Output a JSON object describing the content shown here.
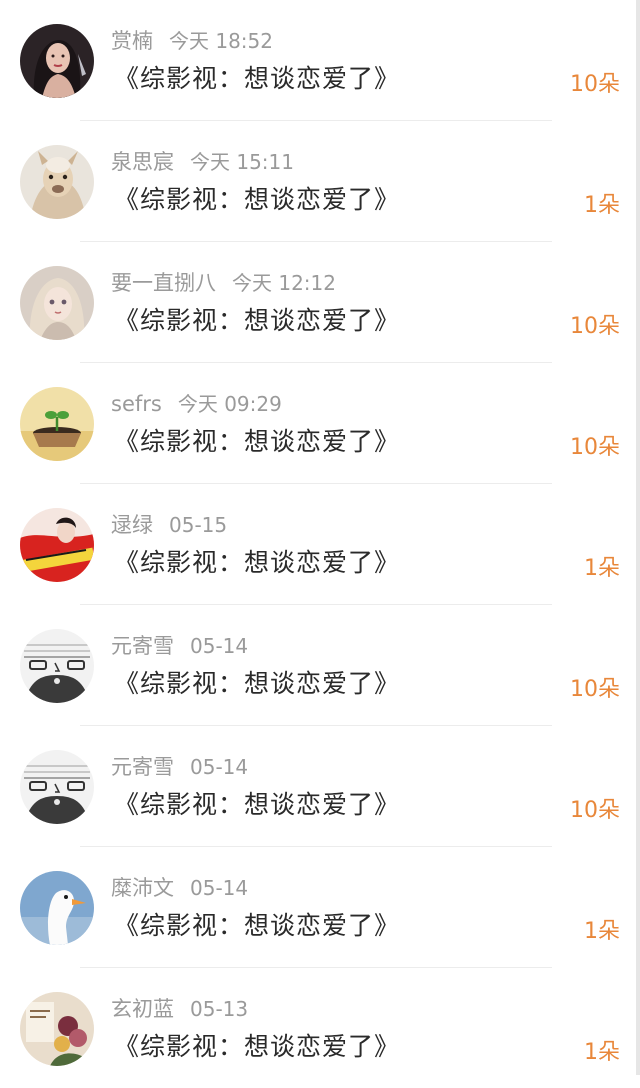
{
  "items": [
    {
      "name": "赏楠",
      "time": "今天 18:52",
      "title": "《综影视：想谈恋爱了》",
      "count": "10朵",
      "avatar": "avatar-woman-dark-hair"
    },
    {
      "name": "泉思宸",
      "time": "今天 15:11",
      "title": "《综影视：想谈恋爱了》",
      "count": "1朵",
      "avatar": "avatar-alpaca"
    },
    {
      "name": "要一直捌八",
      "time": "今天 12:12",
      "title": "《综影视：想谈恋爱了》",
      "count": "10朵",
      "avatar": "avatar-anime-girl"
    },
    {
      "name": "sefrs",
      "time": "今天 09:29",
      "title": "《综影视：想谈恋爱了》",
      "count": "10朵",
      "avatar": "avatar-sprout-pot"
    },
    {
      "name": "逯绿",
      "time": "05-15",
      "title": "《综影视：想谈恋爱了》",
      "count": "1朵",
      "avatar": "avatar-red-dress-woman"
    },
    {
      "name": "元寄雪",
      "time": "05-14",
      "title": "《综影视：想谈恋爱了》",
      "count": "10朵",
      "avatar": "avatar-sketch-face"
    },
    {
      "name": "元寄雪",
      "time": "05-14",
      "title": "《综影视：想谈恋爱了》",
      "count": "10朵",
      "avatar": "avatar-sketch-face"
    },
    {
      "name": "糜沛文",
      "time": "05-14",
      "title": "《综影视：想谈恋爱了》",
      "count": "1朵",
      "avatar": "avatar-goose"
    },
    {
      "name": "玄初蓝",
      "time": "05-13",
      "title": "《综影视：想谈恋爱了》",
      "count": "1朵",
      "avatar": "avatar-flowers-card"
    }
  ]
}
